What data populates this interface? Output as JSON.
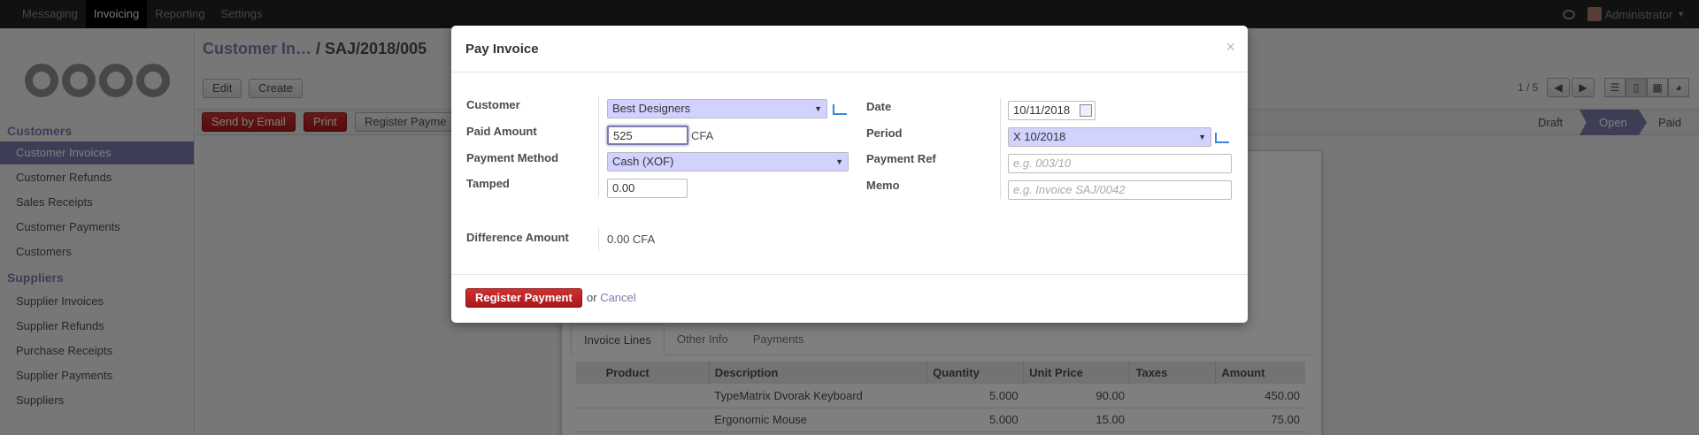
{
  "topnav": {
    "items": [
      "Messaging",
      "Invoicing",
      "Reporting",
      "Settings"
    ],
    "active": "Invoicing",
    "user": "Administrator"
  },
  "sidebar": {
    "logo": "odoo",
    "sections": [
      {
        "title": "Customers",
        "items": [
          "Customer Invoices",
          "Customer Refunds",
          "Sales Receipts",
          "Customer Payments",
          "Customers"
        ]
      },
      {
        "title": "Suppliers",
        "items": [
          "Supplier Invoices",
          "Supplier Refunds",
          "Purchase Receipts",
          "Supplier Payments",
          "Suppliers"
        ]
      }
    ],
    "active_item": "Customer Invoices"
  },
  "main": {
    "breadcrumb_parent": "Customer In…",
    "breadcrumb_sep": " / ",
    "breadcrumb_current": "SAJ/2018/005",
    "edit_label": "Edit",
    "create_label": "Create",
    "send_email_label": "Send by Email",
    "print_label": "Print",
    "register_payment_label": "Register Payme",
    "pager": "1 / 5",
    "statuses": [
      "Draft",
      "Open",
      "Paid"
    ],
    "active_status": "Open",
    "tabs": [
      "Invoice Lines",
      "Other Info",
      "Payments"
    ],
    "lines_headers": [
      "Product",
      "Description",
      "Quantity",
      "Unit Price",
      "Taxes",
      "Amount"
    ],
    "lines": [
      {
        "product": "",
        "description": "TypeMatrix Dvorak Keyboard",
        "quantity": "5.000",
        "unit_price": "90.00",
        "taxes": "",
        "amount": "450.00"
      },
      {
        "product": "",
        "description": "Ergonomic Mouse",
        "quantity": "5.000",
        "unit_price": "15.00",
        "taxes": "",
        "amount": "75.00"
      }
    ]
  },
  "modal": {
    "title": "Pay Invoice",
    "close": "×",
    "customer_label": "Customer",
    "customer_value": "Best Designers",
    "paid_amount_label": "Paid Amount",
    "paid_amount_value": "525",
    "currency": "CFA",
    "payment_method_label": "Payment Method",
    "payment_method_value": "Cash (XOF)",
    "tamped_label": "Tamped",
    "tamped_value": "0.00",
    "date_label": "Date",
    "date_value": "10/11/2018",
    "period_label": "Period",
    "period_value": "X 10/2018",
    "payment_ref_label": "Payment Ref",
    "payment_ref_placeholder": "e.g. 003/10",
    "memo_label": "Memo",
    "memo_placeholder": "e.g. Invoice SAJ/0042",
    "difference_label": "Difference Amount",
    "difference_value": "0.00 CFA",
    "register_label": "Register Payment",
    "or_label": "or",
    "cancel_label": "Cancel"
  }
}
